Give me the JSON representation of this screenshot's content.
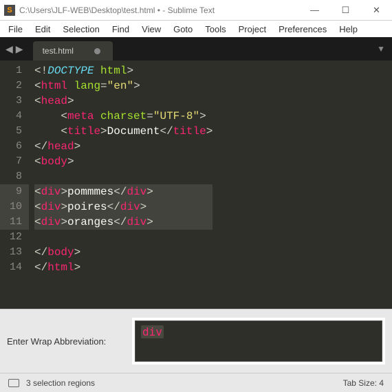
{
  "window": {
    "title": "C:\\Users\\JLF-WEB\\Desktop\\test.html • - Sublime Text",
    "app_icon_letter": "S"
  },
  "menus": [
    "File",
    "Edit",
    "Selection",
    "Find",
    "View",
    "Goto",
    "Tools",
    "Project",
    "Preferences",
    "Help"
  ],
  "tab": {
    "name": "test.html",
    "dirty": true
  },
  "code": {
    "lines": [
      {
        "n": 1,
        "seg": [
          [
            "p-punc",
            "<!"
          ],
          [
            "p-doct",
            "DOCTYPE "
          ],
          [
            "p-attr",
            "html"
          ],
          [
            "p-punc",
            ">"
          ]
        ]
      },
      {
        "n": 2,
        "seg": [
          [
            "p-punc",
            "<"
          ],
          [
            "p-tag",
            "html "
          ],
          [
            "p-attr",
            "lang"
          ],
          [
            "p-punc",
            "="
          ],
          [
            "p-str",
            "\"en\""
          ],
          [
            "p-punc",
            ">"
          ]
        ]
      },
      {
        "n": 3,
        "seg": [
          [
            "p-punc",
            "<"
          ],
          [
            "p-tag",
            "head"
          ],
          [
            "p-punc",
            ">"
          ]
        ]
      },
      {
        "n": 4,
        "seg": [
          [
            "p-text",
            "    "
          ],
          [
            "p-punc",
            "<"
          ],
          [
            "p-tag",
            "meta "
          ],
          [
            "p-attr",
            "charset"
          ],
          [
            "p-punc",
            "="
          ],
          [
            "p-str",
            "\"UTF-8\""
          ],
          [
            "p-punc",
            ">"
          ]
        ]
      },
      {
        "n": 5,
        "seg": [
          [
            "p-text",
            "    "
          ],
          [
            "p-punc",
            "<"
          ],
          [
            "p-tag",
            "title"
          ],
          [
            "p-punc",
            ">"
          ],
          [
            "p-text",
            "Document"
          ],
          [
            "p-punc",
            "</"
          ],
          [
            "p-tag",
            "title"
          ],
          [
            "p-punc",
            ">"
          ]
        ]
      },
      {
        "n": 6,
        "seg": [
          [
            "p-punc",
            "</"
          ],
          [
            "p-tag",
            "head"
          ],
          [
            "p-punc",
            ">"
          ]
        ]
      },
      {
        "n": 7,
        "seg": [
          [
            "p-punc",
            "<"
          ],
          [
            "p-tag",
            "body"
          ],
          [
            "p-punc",
            ">"
          ]
        ]
      },
      {
        "n": 8,
        "seg": []
      },
      {
        "n": 9,
        "hl": true,
        "seg": [
          [
            "p-punc",
            "<"
          ],
          [
            "p-tag",
            "div"
          ],
          [
            "p-punc",
            ">"
          ],
          [
            "p-text",
            "pommmes"
          ],
          [
            "p-punc",
            "</"
          ],
          [
            "p-tag",
            "div"
          ],
          [
            "p-punc",
            ">"
          ]
        ]
      },
      {
        "n": 10,
        "hl": true,
        "seg": [
          [
            "p-punc",
            "<"
          ],
          [
            "p-tag",
            "div"
          ],
          [
            "p-punc",
            ">"
          ],
          [
            "p-text",
            "poires"
          ],
          [
            "p-punc",
            "</"
          ],
          [
            "p-tag",
            "div"
          ],
          [
            "p-punc",
            ">"
          ]
        ]
      },
      {
        "n": 11,
        "hl": true,
        "seg": [
          [
            "p-punc",
            "<"
          ],
          [
            "p-tag",
            "div"
          ],
          [
            "p-punc",
            ">"
          ],
          [
            "p-text",
            "oranges"
          ],
          [
            "p-punc",
            "</"
          ],
          [
            "p-tag",
            "div"
          ],
          [
            "p-punc",
            ">"
          ]
        ]
      },
      {
        "n": 12,
        "seg": []
      },
      {
        "n": 13,
        "seg": [
          [
            "p-punc",
            "</"
          ],
          [
            "p-tag",
            "body"
          ],
          [
            "p-punc",
            ">"
          ]
        ]
      },
      {
        "n": 14,
        "seg": [
          [
            "p-punc",
            "</"
          ],
          [
            "p-tag",
            "html"
          ],
          [
            "p-punc",
            ">"
          ]
        ]
      }
    ]
  },
  "wrap_prompt": {
    "label": "Enter Wrap Abbreviation:",
    "value": "div"
  },
  "status": {
    "left": "3 selection regions",
    "right": "Tab Size: 4"
  }
}
